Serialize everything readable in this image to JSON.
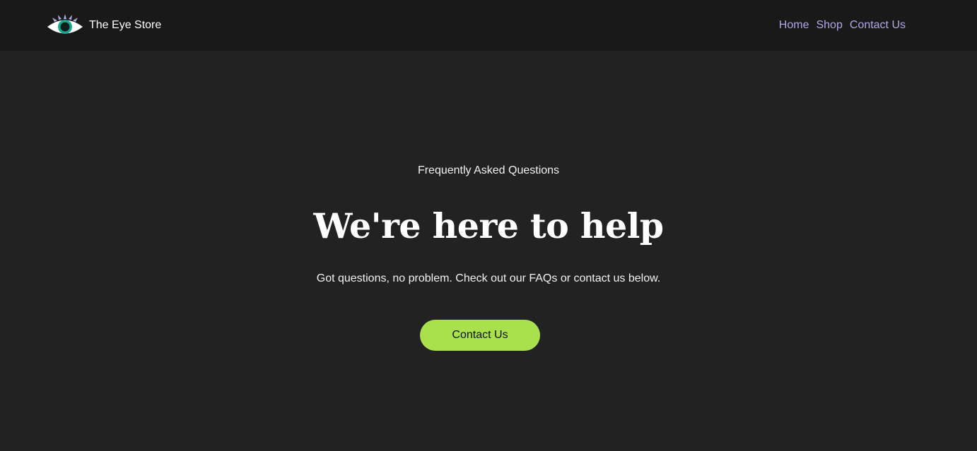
{
  "header": {
    "brand_name": "The Eye Store",
    "logo_icon": "eye-icon",
    "nav": [
      {
        "label": "Home"
      },
      {
        "label": "Shop"
      },
      {
        "label": "Contact Us"
      }
    ]
  },
  "hero": {
    "eyebrow": "Frequently Asked Questions",
    "title": "We're here to help",
    "subtitle": "Got questions, no problem. Check out our FAQs or contact us below.",
    "cta_label": "Contact Us"
  },
  "colors": {
    "page_background": "#222222",
    "header_background": "#191919",
    "nav_link": "#b3a6e8",
    "cta_background": "#a8e14c",
    "logo_iris": "#1aa78e"
  }
}
